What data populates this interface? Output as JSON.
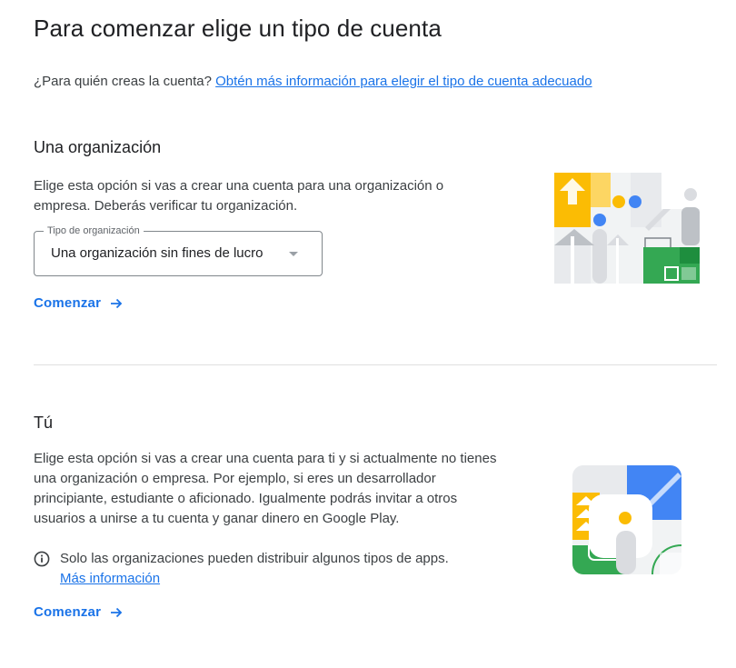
{
  "header": {
    "title": "Para comenzar elige un tipo de cuenta",
    "question": "¿Para quién creas la cuenta?",
    "learn_more_link": "Obtén más información para elegir el tipo de cuenta adecuado"
  },
  "organization": {
    "title": "Una organización",
    "description_line1": "Elige esta opción si vas a crear una cuenta para una organización o",
    "description_line2": "empresa. Deberás verificar tu organización.",
    "select_label": "Tipo de organización",
    "select_value": "Una organización sin fines de lucro",
    "start_label": "Comenzar",
    "icons": {
      "start_arrow": "arrow-right-icon",
      "illustration": "organization-illustration"
    }
  },
  "individual": {
    "title": "Tú",
    "description_lines": [
      "Elige esta opción si vas a crear una cuenta para ti y si actualmente no tienes",
      "una organización o empresa. Por ejemplo, si eres un desarrollador",
      "principiante, estudiante o aficionado. Igualmente podrás invitar a otros",
      "usuarios a unirse a tu cuenta y ganar dinero en Google Play."
    ],
    "info_text": "Solo las organizaciones pueden distribuir algunos tipos de apps.",
    "info_link": "Más información",
    "start_label": "Comenzar",
    "icons": {
      "info": "info-icon",
      "start_arrow": "arrow-right-icon",
      "illustration": "individual-illustration"
    }
  },
  "colors": {
    "accent": "#1a73e8",
    "text": "#202124",
    "muted": "#3c4043",
    "google_yellow": "#fbbc04",
    "google_blue": "#4285f4",
    "google_green": "#34a853",
    "divider": "#e0e0e0"
  }
}
